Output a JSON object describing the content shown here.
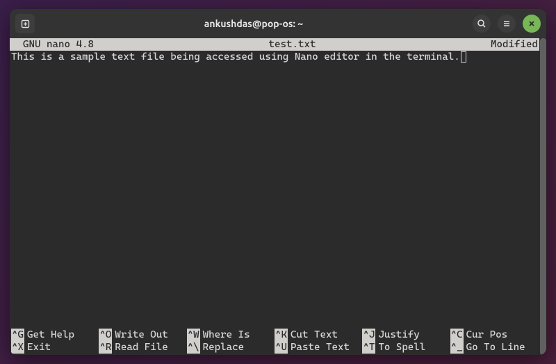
{
  "titlebar": {
    "title": "ankushdas@pop-os: ~"
  },
  "nano": {
    "version_label": "  GNU nano 4.8",
    "filename": "test.txt",
    "status": "Modified",
    "content": "This is a sample text file being accessed using Nano editor in the terminal."
  },
  "shortcuts": {
    "row1": [
      {
        "key": "^G",
        "label": "Get Help"
      },
      {
        "key": "^O",
        "label": "Write Out"
      },
      {
        "key": "^W",
        "label": "Where Is"
      },
      {
        "key": "^K",
        "label": "Cut Text"
      },
      {
        "key": "^J",
        "label": "Justify"
      },
      {
        "key": "^C",
        "label": "Cur Pos"
      }
    ],
    "row2": [
      {
        "key": "^X",
        "label": "Exit"
      },
      {
        "key": "^R",
        "label": "Read File"
      },
      {
        "key": "^\\",
        "label": "Replace"
      },
      {
        "key": "^U",
        "label": "Paste Text"
      },
      {
        "key": "^T",
        "label": "To Spell"
      },
      {
        "key": "^_",
        "label": "Go To Line"
      }
    ]
  }
}
